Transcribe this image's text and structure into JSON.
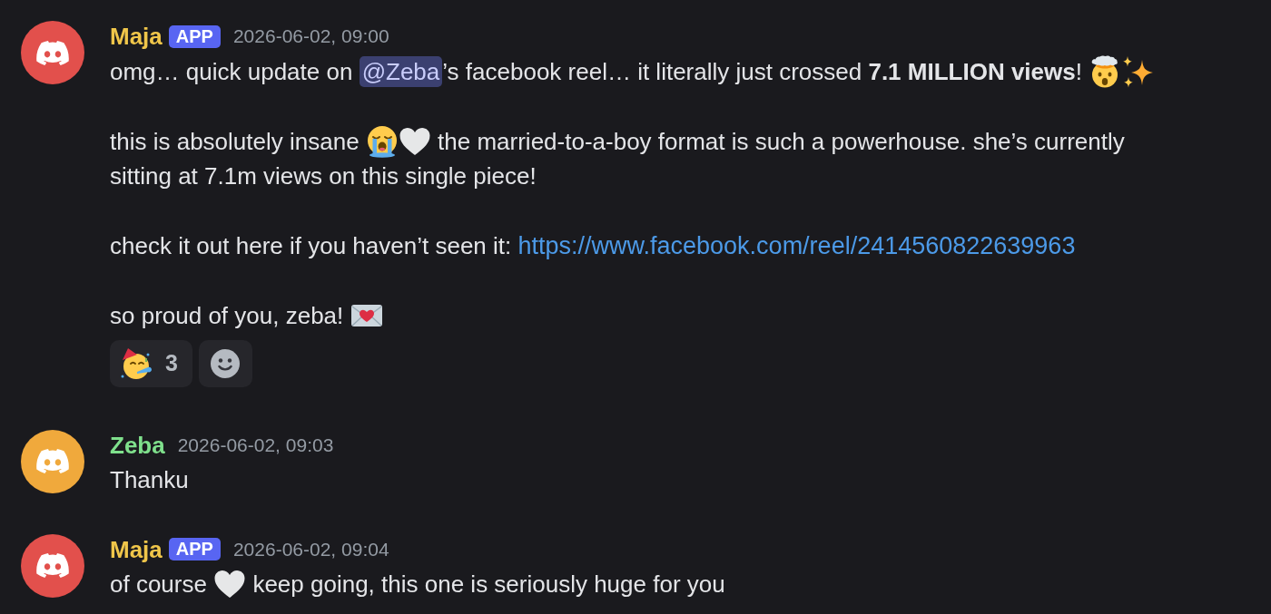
{
  "messages": [
    {
      "author": {
        "name": "Maja",
        "color": "#f0c64a"
      },
      "avatar": {
        "color": "#e2504c"
      },
      "tag": "APP",
      "timestamp": "2026-06-02, 09:00",
      "paragraphs": [
        [
          {
            "kind": "text",
            "text": "omg… quick update on "
          },
          {
            "kind": "mention",
            "text": "@Zeba"
          },
          {
            "kind": "text",
            "text": "’s facebook reel… it literally just crossed **7.1 MILLION views**! "
          },
          {
            "kind": "explodinghead"
          },
          {
            "kind": "sparkles"
          }
        ],
        [
          {
            "kind": "text",
            "text": "this is absolutely insane "
          },
          {
            "kind": "sob"
          },
          {
            "kind": "whiteheart"
          },
          {
            "kind": "text",
            "text": " the married-to-a-boy format is such a powerhouse. she’s currently sitting at 7.1m views on this single piece!"
          }
        ],
        [
          {
            "kind": "text",
            "text": "check it out here if you haven’t seen it: "
          },
          {
            "kind": "link",
            "text": "https://www.facebook.com/reel/2414560822639963"
          }
        ],
        [
          {
            "kind": "text",
            "text": "so proud of you, zeba! "
          },
          {
            "kind": "loveletter"
          }
        ]
      ],
      "reactions": [
        {
          "kind": "partying",
          "count": "3",
          "selected": false
        }
      ],
      "add_reaction": true
    },
    {
      "author": {
        "name": "Zeba",
        "color": "#7fe08c"
      },
      "avatar": {
        "color": "#f0a93c"
      },
      "timestamp": "2026-06-02, 09:03",
      "paragraphs": [
        [
          {
            "kind": "text",
            "text": "Thanku"
          }
        ]
      ]
    },
    {
      "author": {
        "name": "Maja",
        "color": "#f0c64a"
      },
      "avatar": {
        "color": "#e2504c"
      },
      "tag": "APP",
      "timestamp": "2026-06-02, 09:04",
      "paragraphs": [
        [
          {
            "kind": "text",
            "text": "of course "
          },
          {
            "kind": "whiteheart"
          },
          {
            "kind": "text",
            "text": " keep going, this one is seriously huge for you"
          }
        ]
      ]
    }
  ]
}
